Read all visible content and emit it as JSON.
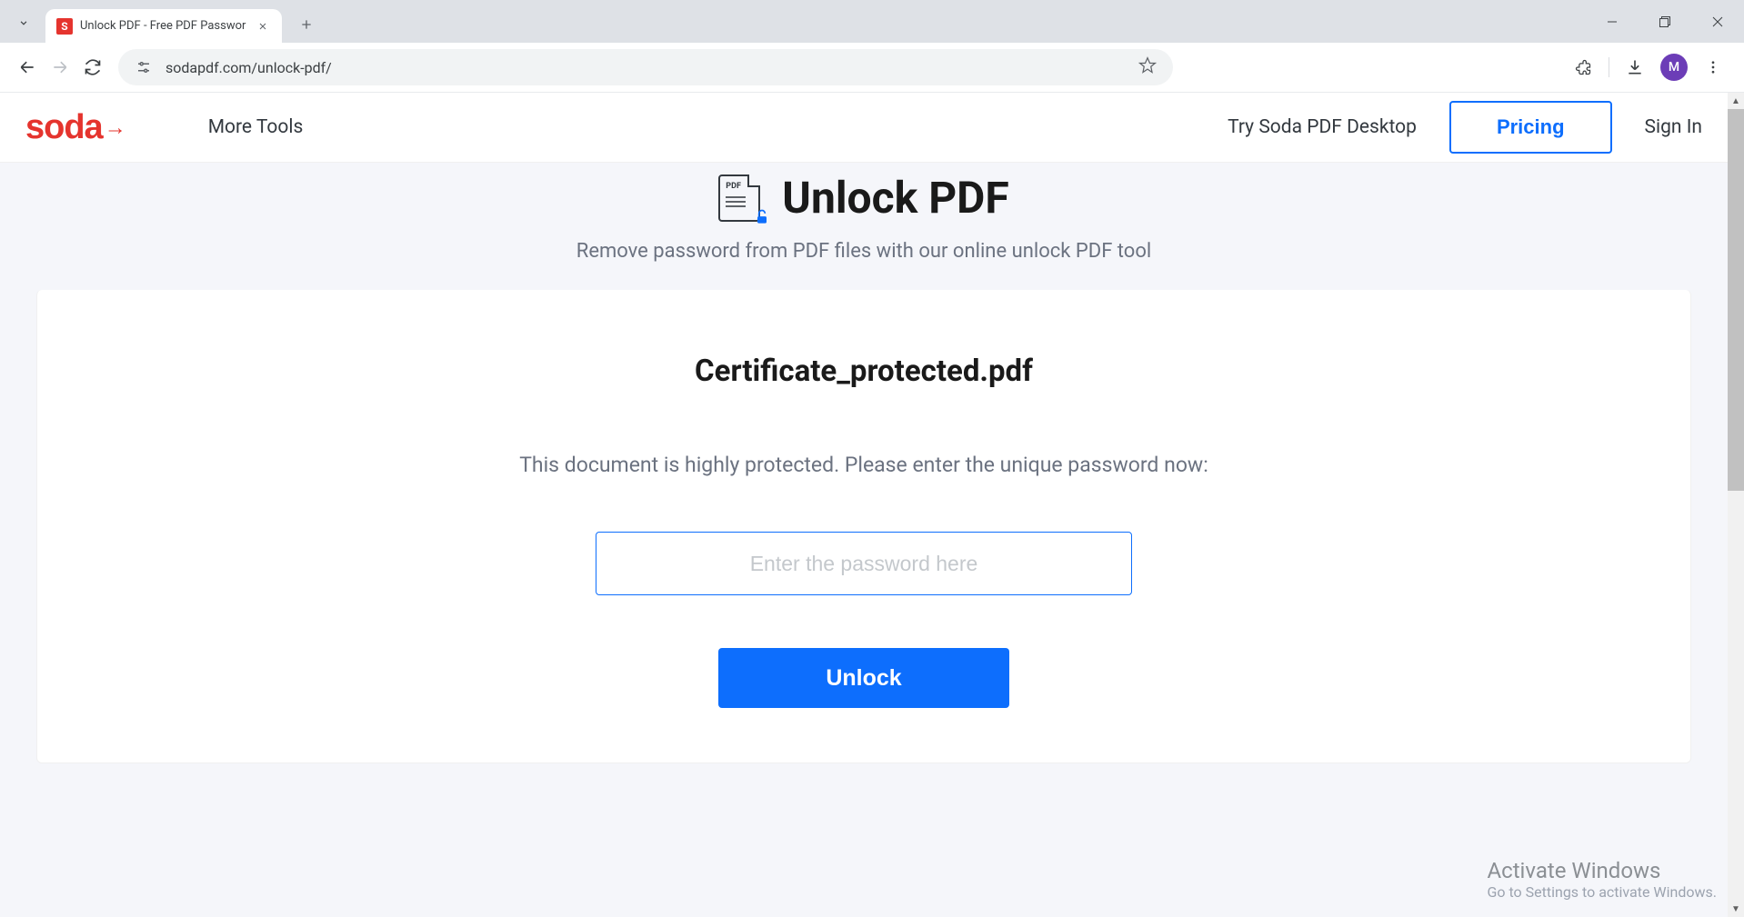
{
  "browser": {
    "tab_title": "Unlock PDF - Free PDF Passwor",
    "tab_favicon_letter": "S",
    "url": "sodapdf.com/unlock-pdf/",
    "profile_letter": "M"
  },
  "header": {
    "logo_text": "soda",
    "nav_more_tools": "More Tools",
    "try_desktop": "Try Soda PDF Desktop",
    "pricing": "Pricing",
    "sign_in": "Sign In"
  },
  "page": {
    "title": "Unlock PDF",
    "subtitle": "Remove password from PDF files with our online unlock PDF tool",
    "icon_pdf_label": "PDF"
  },
  "card": {
    "filename": "Certificate_protected.pdf",
    "instruction": "This document is highly protected. Please enter the unique password now:",
    "password_placeholder": "Enter the password here",
    "unlock_button": "Unlock"
  },
  "watermark": {
    "title": "Activate Windows",
    "subtitle": "Go to Settings to activate Windows."
  }
}
